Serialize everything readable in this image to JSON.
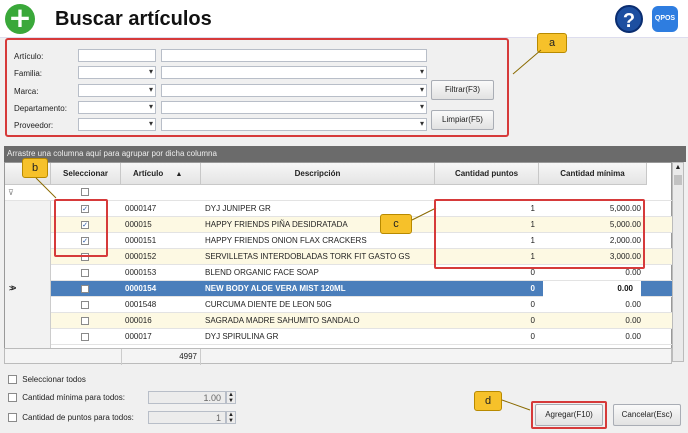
{
  "window": {
    "title": "Buscar artículos",
    "logo_text": "QPOS"
  },
  "filters": {
    "fields": [
      {
        "label": "Artículo:"
      },
      {
        "label": "Familia:"
      },
      {
        "label": "Marca:"
      },
      {
        "label": "Departamento:"
      },
      {
        "label": "Proveedor:"
      }
    ],
    "filter_button": "Filtrar(F3)",
    "clear_button": "Limpiar(F5)"
  },
  "callouts": {
    "a": "a",
    "b": "b",
    "c": "c",
    "d": "d"
  },
  "grid": {
    "group_hint": "Arrastre una columna aquí para agrupar por dicha columna",
    "columns": [
      "Seleccionar",
      "Artículo",
      "Descripción",
      "Cantidad puntos",
      "Cantidad mínima"
    ],
    "sort_indicator": "▲",
    "rows": [
      {
        "selected": true,
        "code": "0000147",
        "desc": "DYJ JUNIPER GR",
        "points": "1",
        "min": "5,000.00"
      },
      {
        "selected": true,
        "code": "000015",
        "desc": "HAPPY FRIENDS PIÑA DESIDRATADA",
        "points": "1",
        "min": "5,000.00"
      },
      {
        "selected": true,
        "code": "0000151",
        "desc": "HAPPY FRIENDS ONION FLAX CRACKERS",
        "points": "1",
        "min": "2,000.00"
      },
      {
        "selected": false,
        "code": "0000152",
        "desc": "SERVILLETAS INTERDOBLADAS TORK FIT GASTO GS",
        "points": "1",
        "min": "3,000.00"
      },
      {
        "selected": false,
        "code": "0000153",
        "desc": "BLEND ORGANIC FACE SOAP",
        "points": "0",
        "min": "0.00"
      },
      {
        "selected": false,
        "code": "0000154",
        "desc": "NEW BODY ALOE VERA MIST 120ML",
        "points": "0",
        "min": "0.00"
      },
      {
        "selected": false,
        "code": "0001548",
        "desc": "CURCUMA DIENTE DE LEON 50G",
        "points": "0",
        "min": "0.00"
      },
      {
        "selected": false,
        "code": "000016",
        "desc": "SAGRADA MADRE SAHUMITO SANDALO",
        "points": "0",
        "min": "0.00"
      },
      {
        "selected": false,
        "code": "000017",
        "desc": "DYJ SPIRULINA GR",
        "points": "0",
        "min": "0.00"
      }
    ],
    "total_count": "4997",
    "current_row_marker": ">"
  },
  "options": {
    "select_all": "Seleccionar todos",
    "min_qty_all": "Cantidad mínima para todos:",
    "min_qty_value": "1.00",
    "points_all": "Cantidad de puntos para todos:",
    "points_value": "1"
  },
  "actions": {
    "add": "Agregar(F10)",
    "cancel": "Cancelar(Esc)"
  }
}
